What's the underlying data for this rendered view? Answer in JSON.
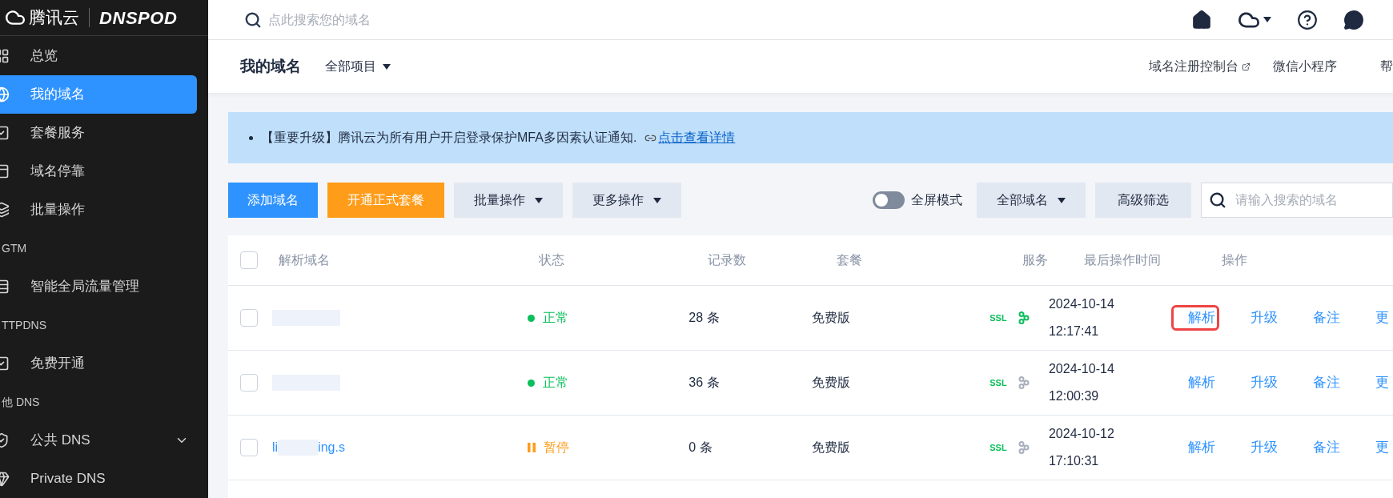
{
  "logo": {
    "brand": "腾讯云",
    "product": "DNSPOD"
  },
  "sidebar": {
    "items": [
      {
        "kind": "item",
        "label": "总览",
        "selected": false,
        "has_submenu": false
      },
      {
        "kind": "item",
        "label": "我的域名",
        "selected": true,
        "has_submenu": false
      },
      {
        "kind": "item",
        "label": "套餐服务",
        "selected": false,
        "has_submenu": false
      },
      {
        "kind": "item",
        "label": "域名停靠",
        "selected": false,
        "has_submenu": false
      },
      {
        "kind": "item",
        "label": "批量操作",
        "selected": false,
        "has_submenu": false
      },
      {
        "kind": "group",
        "label": "GTM"
      },
      {
        "kind": "item",
        "label": "智能全局流量管理",
        "selected": false,
        "has_submenu": false
      },
      {
        "kind": "group",
        "label": "TTPDNS"
      },
      {
        "kind": "item",
        "label": "免费开通",
        "selected": false,
        "has_submenu": false
      },
      {
        "kind": "group",
        "label": "他 DNS"
      },
      {
        "kind": "item",
        "label": "公共 DNS",
        "selected": false,
        "has_submenu": true
      },
      {
        "kind": "item",
        "label": "Private DNS",
        "selected": false,
        "has_submenu": false
      }
    ]
  },
  "topbar": {
    "search_placeholder": "点此搜索您的域名"
  },
  "subheader": {
    "title": "我的域名",
    "project": "全部项目",
    "links": [
      "域名注册控制台",
      "微信小程序"
    ],
    "cut_link": "帮"
  },
  "notice": {
    "text": "【重要升级】腾讯云为所有用户开启登录保护MFA多因素认证通知.",
    "link": "点击查看详情"
  },
  "toolbar": {
    "primary": "添加域名",
    "secondary": "开通正式套餐",
    "dropdowns": [
      "批量操作",
      "更多操作"
    ],
    "toggle": {
      "label": "全屏模式",
      "on": false
    },
    "filter": "全部域名",
    "advanced": "高级筛选",
    "search_placeholder": "请输入搜索的域名"
  },
  "table": {
    "select_all_checked": false,
    "columns": [
      "解析域名",
      "状态",
      "记录数",
      "套餐",
      "服务",
      "最后操作时间",
      "操作"
    ],
    "rows": [
      {
        "checked": false,
        "domain_parts": [],
        "status": {
          "kind": "normal",
          "label": "正常"
        },
        "records": "28 条",
        "plan": "免费版",
        "ssl": "SSL",
        "link_active": true,
        "date": "2024-10-14",
        "time": "12:17:41",
        "actions": [
          {
            "label": "解析",
            "highlighted": true
          },
          {
            "label": "升级",
            "highlighted": false
          },
          {
            "label": "备注",
            "highlighted": false
          },
          {
            "label": "更",
            "highlighted": false
          }
        ]
      },
      {
        "checked": false,
        "domain_parts": [],
        "status": {
          "kind": "normal",
          "label": "正常"
        },
        "records": "36 条",
        "plan": "免费版",
        "ssl": "SSL",
        "link_active": false,
        "date": "2024-10-14",
        "time": "12:00:39",
        "actions": [
          {
            "label": "解析",
            "highlighted": false
          },
          {
            "label": "升级",
            "highlighted": false
          },
          {
            "label": "备注",
            "highlighted": false
          },
          {
            "label": "更",
            "highlighted": false
          }
        ]
      },
      {
        "checked": false,
        "domain_parts": [
          "li",
          "ing.s"
        ],
        "status": {
          "kind": "paused",
          "label": "暂停"
        },
        "records": "0 条",
        "plan": "免费版",
        "ssl": "SSL",
        "link_active": false,
        "date": "2024-10-12",
        "time": "17:10:31",
        "actions": [
          {
            "label": "解析",
            "highlighted": false
          },
          {
            "label": "升级",
            "highlighted": false
          },
          {
            "label": "备注",
            "highlighted": false
          },
          {
            "label": "更",
            "highlighted": false
          }
        ]
      }
    ]
  }
}
